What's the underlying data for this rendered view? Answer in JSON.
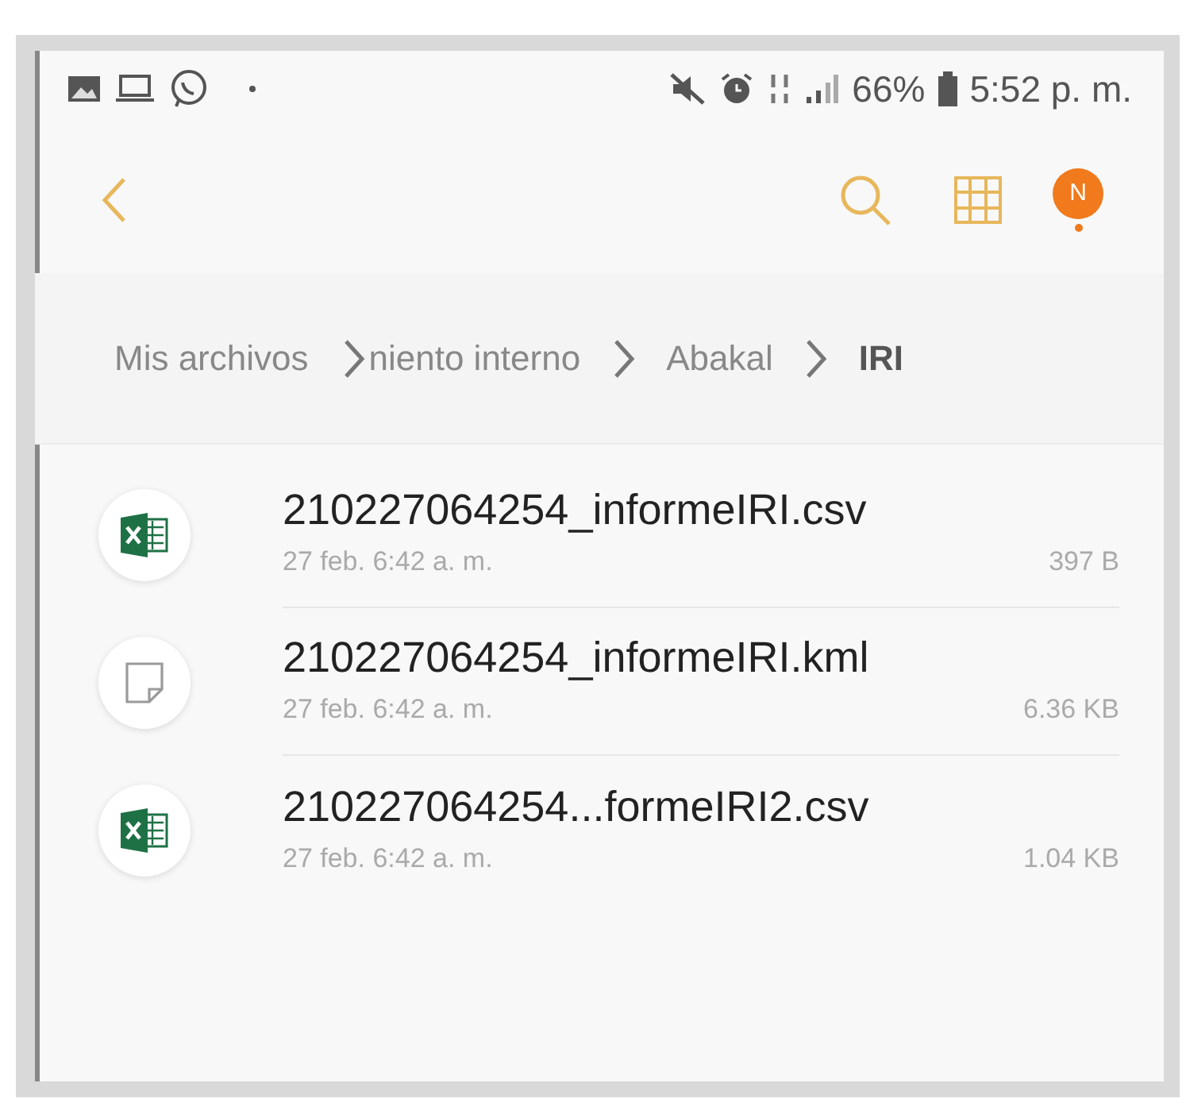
{
  "status_bar": {
    "battery": "66%",
    "time": "5:52 p. m."
  },
  "toolbar": {
    "avatar_letter": "N"
  },
  "breadcrumb": [
    {
      "label": "Mis archivos",
      "selected": false
    },
    {
      "label": "niento interno",
      "selected": false
    },
    {
      "label": "Abakal",
      "selected": false
    },
    {
      "label": "IRI",
      "selected": true
    }
  ],
  "files": [
    {
      "kind": "spreadsheet",
      "name": "210227064254_informeIRI.csv",
      "date": "27 feb. 6:42 a. m.",
      "size": "397 B"
    },
    {
      "kind": "generic",
      "name": "210227064254_informeIRI.kml",
      "date": "27 feb. 6:42 a. m.",
      "size": "6.36 KB"
    },
    {
      "kind": "spreadsheet",
      "name": "210227064254...formeIRI2.csv",
      "date": "27 feb. 6:42 a. m.",
      "size": "1.04 KB"
    }
  ]
}
